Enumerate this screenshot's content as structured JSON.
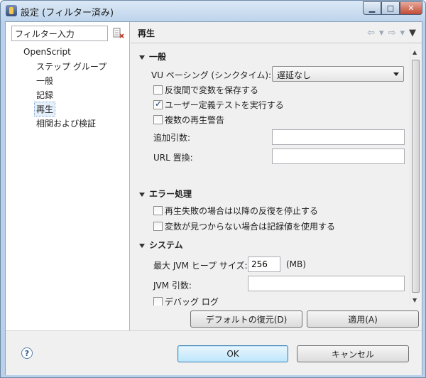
{
  "window": {
    "title": "設定 (フィルター済み)",
    "controls": {
      "minimize": "▁",
      "maximize": "□",
      "close": "✕"
    }
  },
  "left": {
    "filter_value": "フィルター入力",
    "tree": [
      {
        "label": "OpenScript",
        "level": 0
      },
      {
        "label": "ステップ グループ",
        "level": 1
      },
      {
        "label": "一般",
        "level": 1
      },
      {
        "label": "記録",
        "level": 1
      },
      {
        "label": "再生",
        "level": 1,
        "selected": true
      },
      {
        "label": "相関および検証",
        "level": 1
      }
    ]
  },
  "page": {
    "title": "再生",
    "sections": {
      "general": {
        "title": "一般",
        "vu_pacing_label": "VU ペーシング (シンクタイム):",
        "vu_pacing_value": "遅延なし",
        "checkboxes": [
          {
            "label": "反復間で変数を保存する",
            "checked": false
          },
          {
            "label": "ユーザー定義テストを実行する",
            "checked": true
          },
          {
            "label": "複数の再生警告",
            "checked": false
          }
        ],
        "extra_args_label": "追加引数:",
        "extra_args_value": "",
        "url_replace_label": "URL 置換:",
        "url_replace_value": ""
      },
      "errors": {
        "title": "エラー処理",
        "checkboxes": [
          {
            "label": "再生失敗の場合は以降の反復を停止する",
            "checked": false
          },
          {
            "label": "変数が見つからない場合は記録値を使用する",
            "checked": false
          }
        ]
      },
      "system": {
        "title": "システム",
        "heap_label": "最大 JVM ヒープ サイズ:",
        "heap_value": "256",
        "heap_unit": "(MB)",
        "jvm_args_label": "JVM 引数:",
        "jvm_args_value": "",
        "debug_log_label": "デバッグ ログ"
      }
    },
    "buttons": {
      "restore_defaults": "デフォルトの復元(D)",
      "apply": "適用(A)"
    }
  },
  "footer": {
    "help": "?",
    "ok": "OK",
    "cancel": "キャンセル"
  }
}
